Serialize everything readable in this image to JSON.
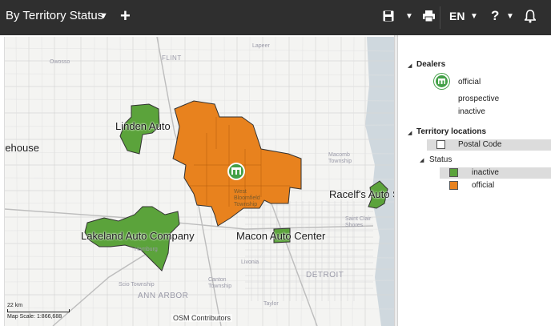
{
  "toolbar": {
    "view_title": "By Territory Status",
    "language": "EN",
    "help": "?",
    "icons": [
      "caret-down-icon",
      "plus-icon",
      "save-icon",
      "print-icon",
      "help-icon",
      "bell-icon"
    ]
  },
  "map": {
    "territory_labels": [
      "Linden Auto",
      "Lakeland Auto Company",
      "Macon Auto Center",
      "Racelf's Auto S",
      "rehouse"
    ],
    "place_labels": [
      "Owosso",
      "FLINT",
      "Lapeer",
      "Macomb Township",
      "West Bloomfield Township",
      "Saint Clair Shores",
      "Hamburg",
      "Livonia",
      "Canton Township",
      "Scio Township",
      "ANN ARBOR",
      "DETROIT",
      "Taylor"
    ],
    "scale_distance": "22 km",
    "scale_text": "Map Scale: 1:866,688",
    "attribution": "OSM Contributors",
    "colors": {
      "inactive": "#5ba33b",
      "official": "#e8821e",
      "background": "#f4f4f2",
      "water": "#cfd8de"
    }
  },
  "legend": {
    "dealers_title": "Dealers",
    "dealer_items": [
      "official",
      "prospective",
      "inactive"
    ],
    "territory_title": "Territory locations",
    "postal_code": "Postal Code",
    "status_title": "Status",
    "status_items": [
      {
        "label": "inactive",
        "color": "#5ba33b"
      },
      {
        "label": "official",
        "color": "#e8821e"
      }
    ]
  }
}
